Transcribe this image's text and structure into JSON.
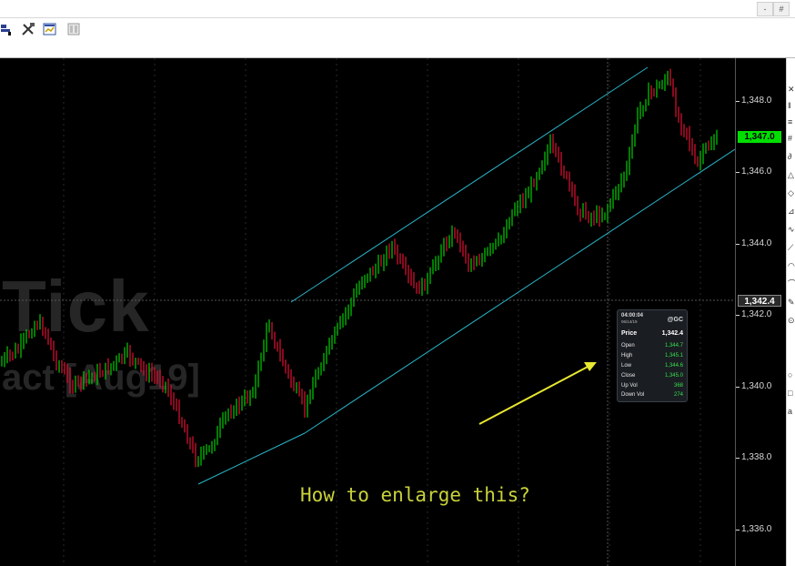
{
  "window": {
    "buttons": [
      {
        "name": "minimize",
        "label": "-"
      },
      {
        "name": "restore",
        "label": "#"
      }
    ]
  },
  "toolbar": {
    "icons": [
      "chart-style-icon",
      "tools-icon",
      "insert-indicator-icon",
      "panel-icon"
    ]
  },
  "chart": {
    "watermark_line1": "Tick",
    "watermark_line2": "act [Aug19]",
    "annotation_text": "How to enlarge this?",
    "annotation_color": "#c8d23a",
    "arrow_color": "#e8e830",
    "channel_color": "#2ab5c8",
    "up_color": "#00c000",
    "down_color": "#d01030"
  },
  "price_axis": {
    "labels": [
      "1,348.0",
      "1,346.0",
      "1,344.0",
      "1,342.0",
      "1,340.0",
      "1,338.0",
      "1,336.0"
    ],
    "current_price": "1,347.0",
    "crosshair_price": "1,342.4"
  },
  "tooltip": {
    "time": "04:00:04",
    "date": "06/14/19",
    "symbol": "@GC",
    "price_label": "Price",
    "price_value": "1,342.4",
    "rows": [
      {
        "label": "Open",
        "value": "1,344.7"
      },
      {
        "label": "High",
        "value": "1,345.1"
      },
      {
        "label": "Low",
        "value": "1,344.6"
      },
      {
        "label": "Close",
        "value": "1,345.0"
      },
      {
        "label": "Up Vol",
        "value": "368"
      },
      {
        "label": "Down Vol",
        "value": "274"
      }
    ]
  },
  "right_toolbar": {
    "icons": [
      "crosshair-icon",
      "bars-icon",
      "lines-icon",
      "grid-icon",
      "draw-icon",
      "fib-icon",
      "diamond-icon",
      "ruler-icon",
      "wave-icon",
      "trend-icon",
      "shape-icon",
      "arc-icon",
      "pen-icon",
      "target-icon",
      "zoom-icon",
      "rect-icon"
    ],
    "bottom_text": "a"
  }
}
